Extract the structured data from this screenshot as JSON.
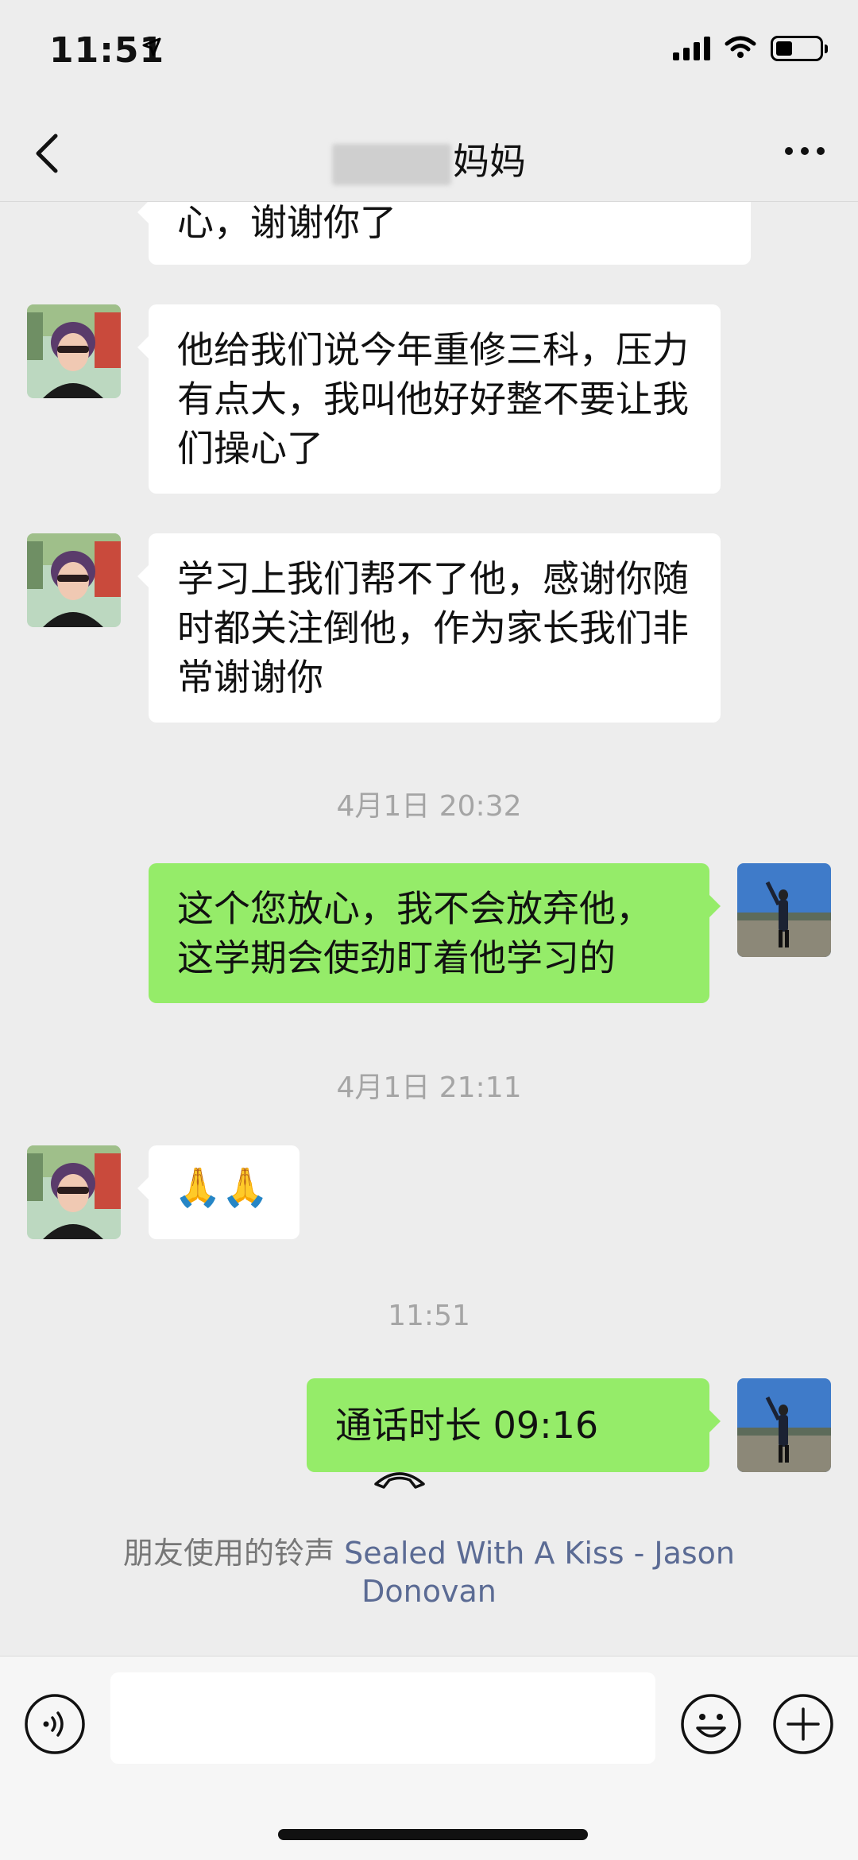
{
  "status": {
    "time": "11:51"
  },
  "header": {
    "title_suffix": "妈妈"
  },
  "messages": {
    "m1": "心，谢谢你了",
    "m2": "他给我们说今年重修三科，压力有点大，我叫他好好整不要让我们操心了",
    "m3": "学习上我们帮不了他，感谢你随时都关注倒他，作为家长我们非常谢谢你",
    "t1": "4月1日 20:32",
    "m4": "这个您放心，我不会放弃他，这学期会使劲盯着他学习的",
    "t2": "4月1日 21:11",
    "m5": "🙏🙏",
    "t3": "11:51",
    "call": "通话时长 09:16"
  },
  "ringtone": {
    "prefix": "朋友使用的铃声 ",
    "song": "Sealed With A Kiss - Jason Donovan"
  },
  "icons": {
    "back": "chevron-left-icon",
    "more": "more-icon",
    "voice": "voice-icon",
    "emoji": "emoji-icon",
    "plus": "plus-icon",
    "call": "phone-hangup-icon"
  },
  "colors": {
    "background": "#ededed",
    "outgoing_bubble": "#95ec69",
    "incoming_bubble": "#ffffff",
    "link": "#5b6b94"
  }
}
